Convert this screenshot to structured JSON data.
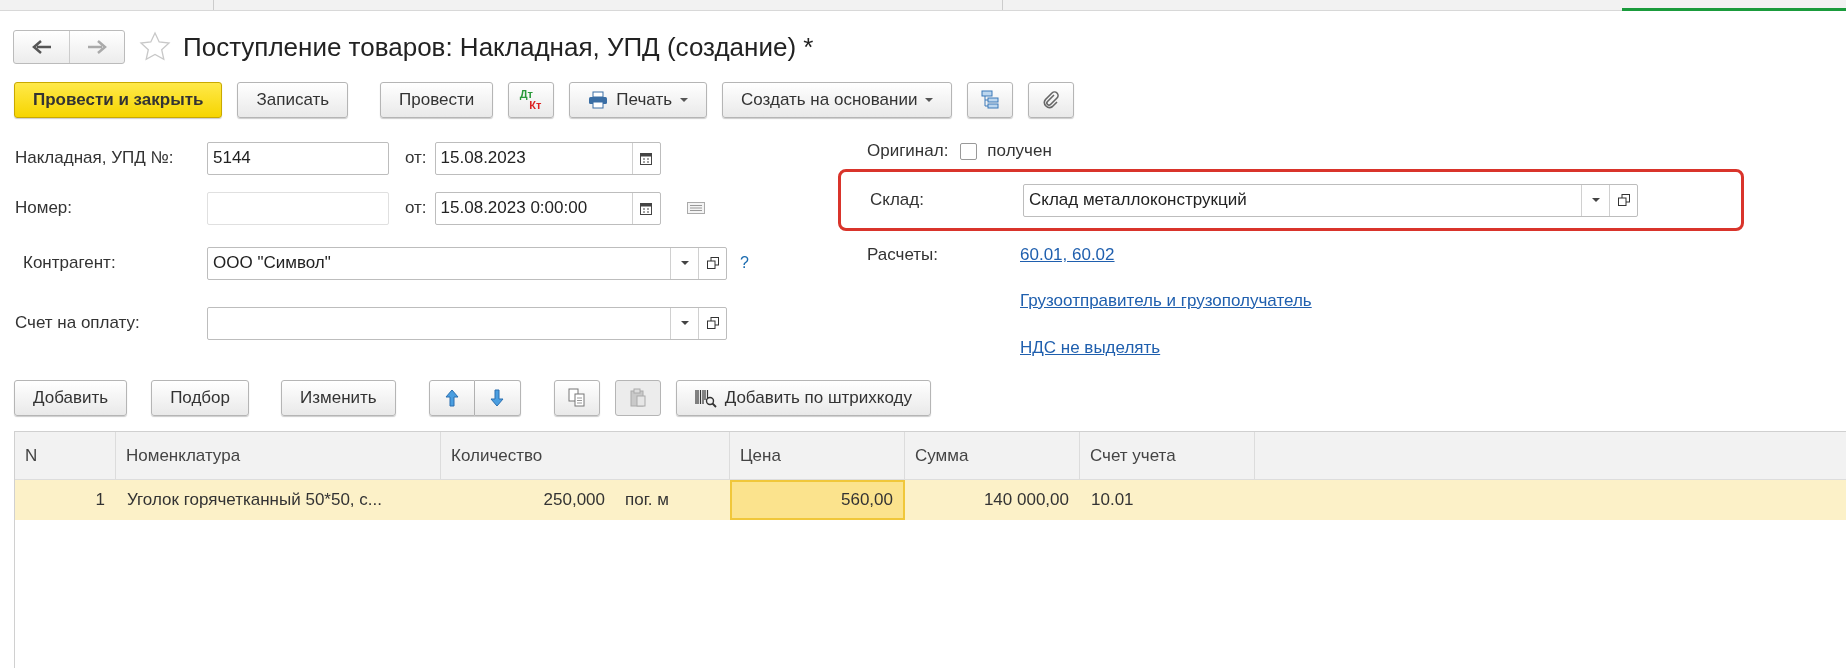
{
  "nav": [
    {
      "kind": "back",
      "disabled": false
    },
    {
      "kind": "forward",
      "disabled": true
    }
  ],
  "title": "Поступление товаров: Накладная, УПД (создание) *",
  "toolbar": [
    {
      "kind": "primary",
      "label": "Провести и закрыть"
    },
    {
      "kind": "button",
      "label": "Записать"
    },
    {
      "kind": "button",
      "label": "Провести"
    },
    {
      "kind": "dtkt",
      "dt": "Дт",
      "kt": "Кт"
    },
    {
      "kind": "print",
      "label": "Печать"
    },
    {
      "kind": "menu",
      "label": "Создать на основании"
    },
    {
      "kind": "structure"
    },
    {
      "kind": "attach"
    }
  ],
  "header_fields": {
    "invoice_label": "Накладная, УПД №:",
    "invoice_number": "5144",
    "date_label": "от:",
    "date": "15.08.2023",
    "number_label": "Номер:",
    "date2_label": "от:",
    "datetime": "15.08.2023  0:00:00",
    "counterparty_label": "Контрагент:",
    "counterparty": "ООО \"Символ\"",
    "help": "?",
    "payment_invoice_label": "Счет на оплату:"
  },
  "right_fields": {
    "original_label": "Оригинал:",
    "original_received": {
      "label": "получен",
      "checked": false
    },
    "warehouse_label": "Склад:",
    "warehouse": "Склад металлоконструкций",
    "warehouse_highlighted": true,
    "settlements_label": "Расчеты:",
    "settlements_link": "60.01, 60.02",
    "links": [
      "Грузоотправитель и грузополучатель",
      "НДС не выделять"
    ]
  },
  "table_toolbar": [
    {
      "kind": "button",
      "label": "Добавить",
      "disabled": false
    },
    {
      "kind": "button",
      "label": "Подбор",
      "disabled": false
    },
    {
      "kind": "button",
      "label": "Изменить",
      "disabled": false
    },
    {
      "kind": "up",
      "disabled": false
    },
    {
      "kind": "down",
      "disabled": false
    },
    {
      "kind": "copy",
      "disabled": false
    },
    {
      "kind": "paste",
      "disabled": true
    },
    {
      "kind": "barcode",
      "label": "Добавить по штрихкоду",
      "disabled": false
    }
  ],
  "table": {
    "columns": [
      "N",
      "Номенклатура",
      "Количество",
      "Цена",
      "Сумма",
      "Счет учета"
    ],
    "rows": [
      {
        "selected": true,
        "cells": [
          {
            "text": "1",
            "current": false
          },
          {
            "text": "Уголок горячетканный 50*50, с...",
            "current": false
          },
          {
            "text": "250,000",
            "unit": "пог. м",
            "current": false
          },
          {
            "text": "560,00",
            "current": true
          },
          {
            "text": "140 000,00",
            "current": false
          },
          {
            "text": "10.01",
            "current": false
          }
        ]
      }
    ]
  }
}
